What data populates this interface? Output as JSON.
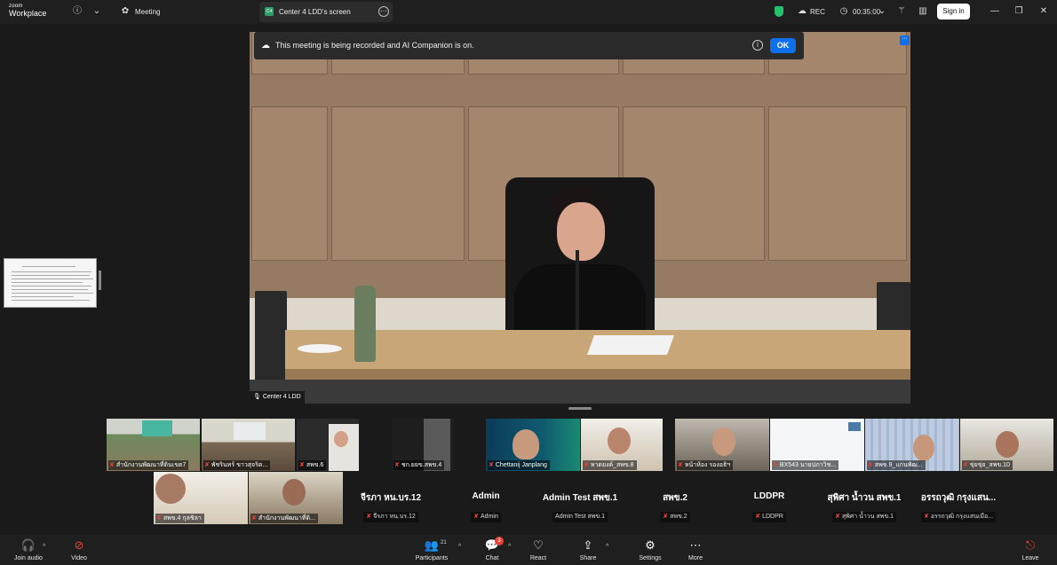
{
  "app": {
    "brand_line1": "zoom",
    "brand_line2": "Workplace",
    "meeting_label": "Meeting"
  },
  "share_tab": {
    "icon_text": "C4",
    "title": "Center 4 LDD's screen"
  },
  "status": {
    "rec_label": "REC",
    "timer": "00:35:00",
    "signin_label": "Sign in"
  },
  "notice": {
    "message": "This meeting is being recorded and AI Companion is on.",
    "ok_label": "OK"
  },
  "share": {
    "presenter": "Center 4 LDD"
  },
  "gallery": {
    "video_tiles": [
      {
        "name": "สำนักงานพัฒนาที่ดินเขต7",
        "muted": true
      },
      {
        "name": "พัชรินทร์ ขาวสุจริต...",
        "muted": true
      },
      {
        "name": "สพข.6",
        "muted": true
      },
      {
        "name": "ชก.ยยข.สพข.4",
        "muted": true
      },
      {
        "name": "Chettanij Janplang",
        "muted": true
      },
      {
        "name": "หาดยงค์_สพข.8",
        "muted": true
      },
      {
        "name": "หน้าห้อง รองอธิฯ",
        "muted": true
      },
      {
        "name": "BX543 นายปภาวิช...",
        "muted": true
      },
      {
        "name": "สพข.9_แก่นพัฒ...",
        "muted": true
      },
      {
        "name": "ขุ่ยขุ่ย_สพข.10",
        "muted": true
      },
      {
        "name": "สพข.4 กุลชิลา",
        "muted": true
      },
      {
        "name": "สำนักงานพัฒนาที่ดิ...",
        "muted": true
      }
    ],
    "name_tiles": [
      {
        "big": "จีรภา หน.บร.12",
        "small": "จีรภา หน.บร.12",
        "muted": true
      },
      {
        "big": "Admin",
        "small": "Admin",
        "muted": true
      },
      {
        "big": "Admin Test สพข.1",
        "small": "Admin Test สพข.1",
        "muted": false
      },
      {
        "big": "สพข.2",
        "small": "สพข.2",
        "muted": true
      },
      {
        "big": "LDDPR",
        "small": "LDDPR",
        "muted": true
      },
      {
        "big": "สุพิศา  น้ำวน สพข.1",
        "small": "สุพิศา  น้ำวน สพข.1",
        "muted": true
      },
      {
        "big": "อรรถวุฒิ กรุงแสน...",
        "small": "อรรถวุฒิ กรุงแสนเมือ...",
        "muted": true
      }
    ]
  },
  "toolbar": {
    "join_audio": "Join audio",
    "video": "Video",
    "participants": "Participants",
    "participants_count": "21",
    "chat": "Chat",
    "chat_badge": "3",
    "react": "React",
    "share": "Share",
    "settings": "Settings",
    "more": "More",
    "leave": "Leave"
  },
  "colors": {
    "accent": "#0e71eb",
    "muted": "#e8443a",
    "shield": "#23c16b"
  }
}
